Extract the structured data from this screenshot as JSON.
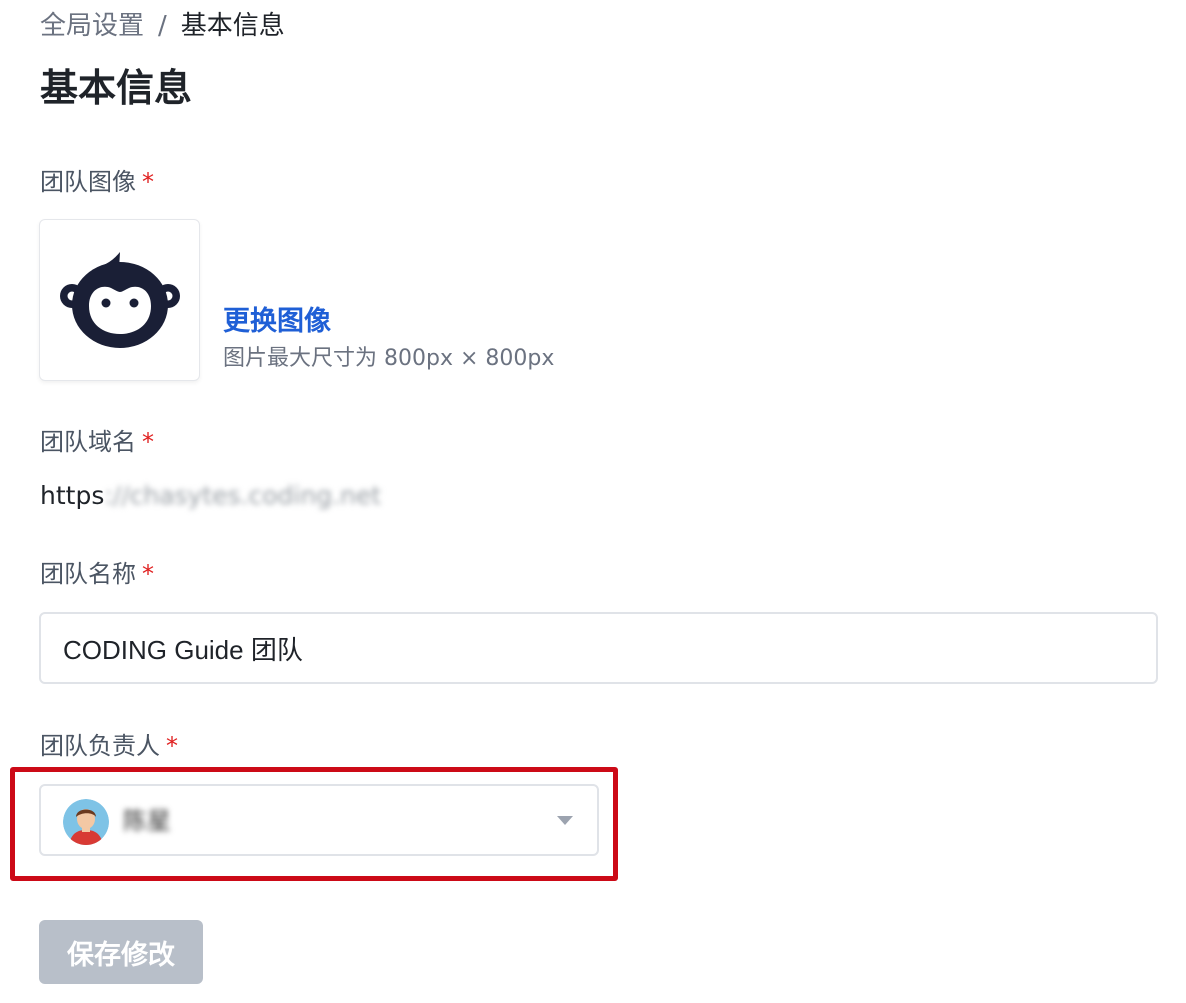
{
  "breadcrumb": {
    "parent": "全局设置",
    "separator": "/",
    "current": "基本信息"
  },
  "page_title": "基本信息",
  "avatar_section": {
    "label": "团队图像",
    "required_mark": "*",
    "change_link": "更换图像",
    "hint": "图片最大尺寸为 800px × 800px",
    "icon": "monkey-logo-icon"
  },
  "domain_section": {
    "label": "团队域名",
    "required_mark": "*",
    "value_visible": "https",
    "value_blurred": "://chasytes.coding.net"
  },
  "name_section": {
    "label": "团队名称",
    "required_mark": "*",
    "value": "CODING Guide 团队"
  },
  "owner_section": {
    "label": "团队负责人",
    "required_mark": "*",
    "selected_name": "陈星",
    "caret_icon": "caret-down-icon",
    "highlight_color": "#cc0a17"
  },
  "save_button": {
    "label": "保存修改",
    "state": "disabled"
  },
  "colors": {
    "link": "#1f5fd6",
    "required": "#e02020",
    "disabled_button": "#b8bfc9"
  }
}
